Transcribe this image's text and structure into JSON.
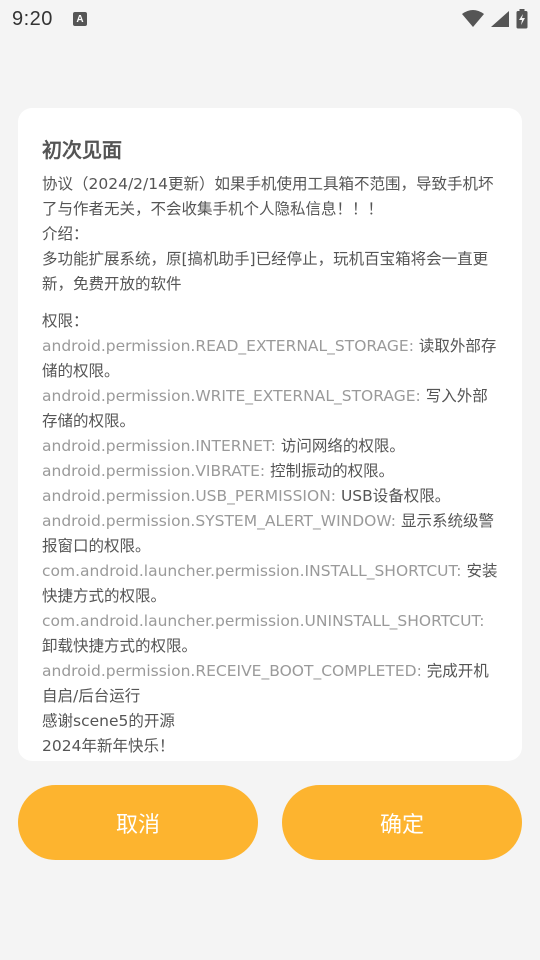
{
  "status_bar": {
    "time": "9:20",
    "notification_icon": "A",
    "icons": [
      "wifi-icon",
      "signal-icon",
      "battery-charging-icon"
    ]
  },
  "dialog": {
    "title": "初次见面",
    "intro_lines": [
      "协议（2024/2/14更新）如果手机使用工具箱不范围，导致手机坏了与作者无关，不会收集手机个人隐私信息！！！",
      "介绍：",
      "多功能扩展系统，原[搞机助手]已经停止，玩机百宝箱将会一直更新，免费开放的软件"
    ],
    "permissions_header": "权限：",
    "permissions": [
      {
        "name": "android.permission.READ_EXTERNAL_STORAGE:",
        "desc": " 读取外部存储的权限。"
      },
      {
        "name": "android.permission.WRITE_EXTERNAL_STORAGE:",
        "desc": " 写入外部存储的权限。"
      },
      {
        "name": "android.permission.INTERNET:",
        "desc": " 访问网络的权限。"
      },
      {
        "name": "android.permission.VIBRATE:",
        "desc": " 控制振动的权限。"
      },
      {
        "name": "android.permission.USB_PERMISSION:",
        "desc": " USB设备权限。"
      },
      {
        "name": "android.permission.SYSTEM_ALERT_WINDOW:",
        "desc": " 显示系统级警报窗口的权限。"
      },
      {
        "name": "com.android.launcher.permission.INSTALL_SHORTCUT:",
        "desc": " 安装快捷方式的权限。"
      },
      {
        "name": "com.android.launcher.permission.UNINSTALL_SHORTCUT:",
        "desc": " 卸载快捷方式的权限。"
      },
      {
        "name": "android.permission.RECEIVE_BOOT_COMPLETED:",
        "desc": " 完成开机自启/后台运行"
      }
    ],
    "thanks": "感谢scene5的开源",
    "new_year": "2024年新年快乐！"
  },
  "buttons": {
    "cancel_label": "取消",
    "ok_label": "确定"
  },
  "colors": {
    "accent": "#fdb42f",
    "background": "#f4f4f4",
    "card": "#ffffff"
  }
}
